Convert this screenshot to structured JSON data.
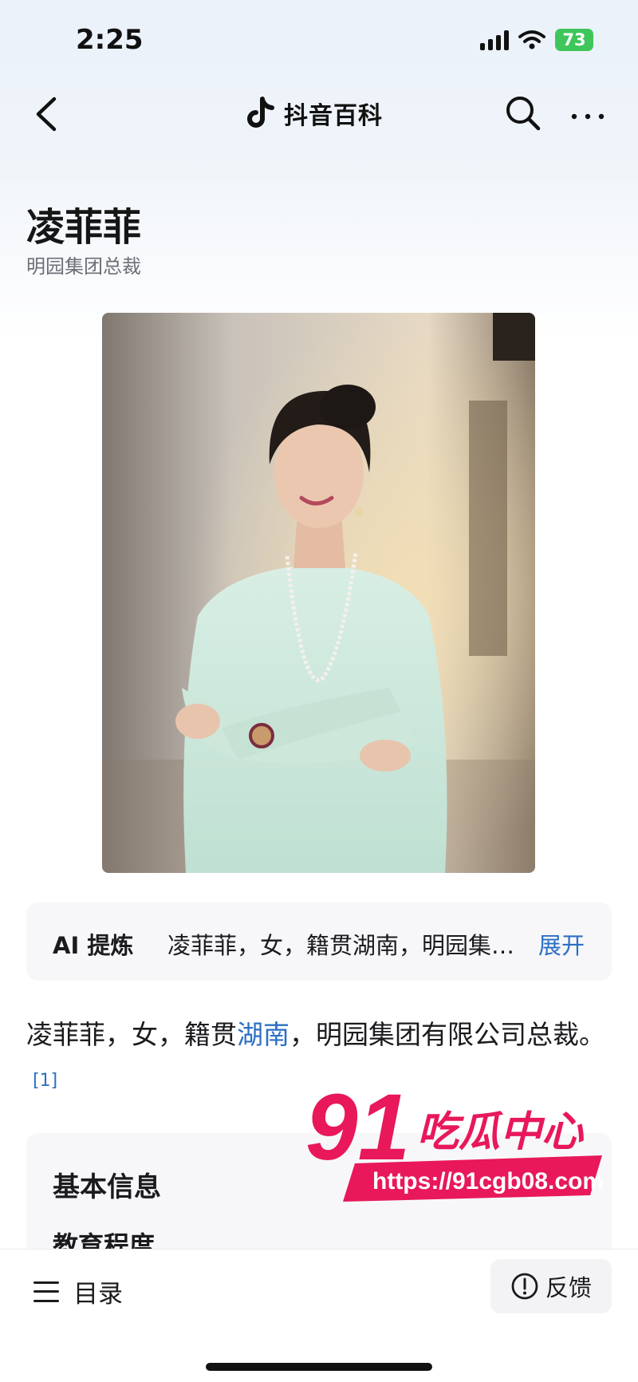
{
  "status": {
    "time": "2:25",
    "battery": "73"
  },
  "nav": {
    "brand": "抖音百科"
  },
  "entry": {
    "name": "凌菲菲",
    "role": "明园集团总裁"
  },
  "ai_summary": {
    "label": "AI 提炼",
    "text": "凌菲菲，女，籍贯湖南，明园集…",
    "expand": "展开"
  },
  "intro": {
    "part1": "凌菲菲，女，籍贯",
    "link": "湖南",
    "part2": "，明园集团有限公司总裁。",
    "ref": "[1]"
  },
  "info": {
    "heading": "基本信息",
    "row1_label": "教育程度"
  },
  "bottom": {
    "toc": "目录",
    "feedback": "反馈"
  },
  "watermark": {
    "brand_num": "91",
    "brand_text": "吃瓜中心",
    "url": "https://91cgb08.com"
  },
  "colors": {
    "link": "#2c6fc4",
    "watermark": "#e8185a",
    "battery": "#3ec65b"
  }
}
